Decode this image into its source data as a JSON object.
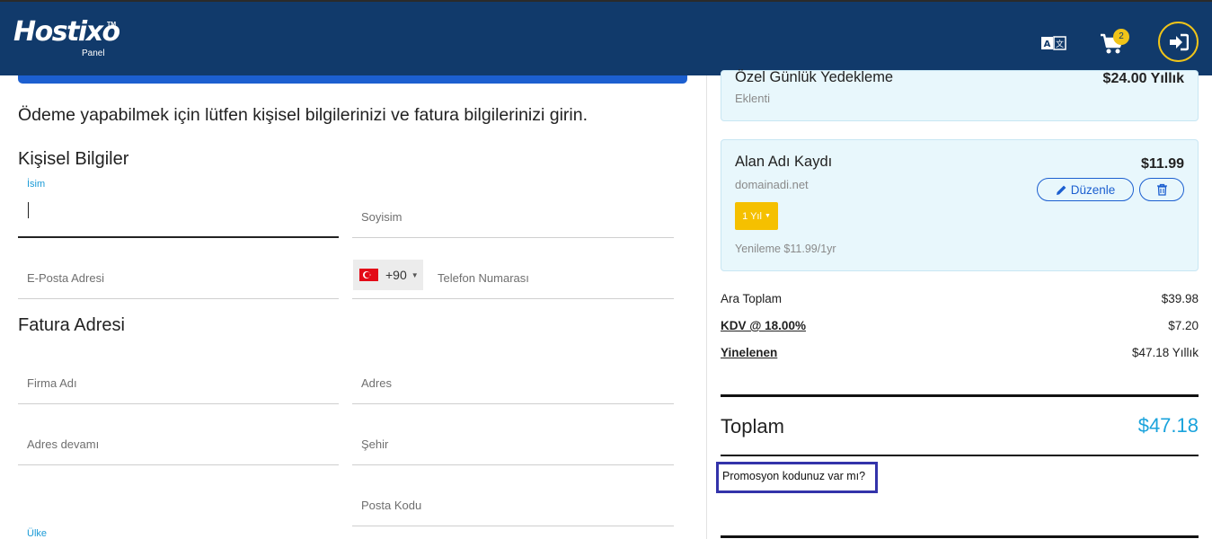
{
  "header": {
    "logo_text": "Hostixo",
    "logo_tm": "TM",
    "logo_sub": "Panel",
    "cart_count": "2",
    "colors": {
      "bar": "#113a6b",
      "accent": "#f0c419"
    },
    "icons": [
      "translate-icon",
      "cart-icon",
      "login-icon"
    ]
  },
  "intro_text": "Ödeme yapabilmek için lütfen kişisel bilgilerinizi ve fatura bilgilerinizi girin.",
  "personal": {
    "title": "Kişisel Bilgiler",
    "first_name_label": "İsim",
    "first_name_value": "",
    "last_name_placeholder": "Soyisim",
    "email_placeholder": "E-Posta Adresi",
    "country_code": "+90",
    "phone_placeholder": "Telefon Numarası"
  },
  "billing": {
    "title": "Fatura Adresi",
    "company_placeholder": "Firma Adı",
    "address_placeholder": "Adres",
    "address2_placeholder": "Adres devamı",
    "city_placeholder": "Şehir",
    "state_placeholder": "",
    "postcode_placeholder": "Posta Kodu",
    "country_label": "Ülke"
  },
  "cart": {
    "item1": {
      "title": "Özel Günlük Yedekleme",
      "subtitle": "Eklenti",
      "price": "$24.00 Yıllık"
    },
    "item2": {
      "title": "Alan Adı Kaydı",
      "domain": "domainadi.net",
      "price": "$11.99",
      "edit_label": "Düzenle",
      "period": "1 Yıl",
      "renewal": "Yenileme $11.99/1yr"
    }
  },
  "summary": {
    "subtotal_label": "Ara Toplam",
    "subtotal_value": "$39.98",
    "tax_label": "KDV @ 18.00%",
    "tax_value": "$7.20",
    "recurring_label": "Yinelenen",
    "recurring_value": "$47.18 Yıllık",
    "total_label": "Toplam",
    "total_value": "$47.18",
    "promo_text": "Promosyon kodunuz var mı?"
  }
}
